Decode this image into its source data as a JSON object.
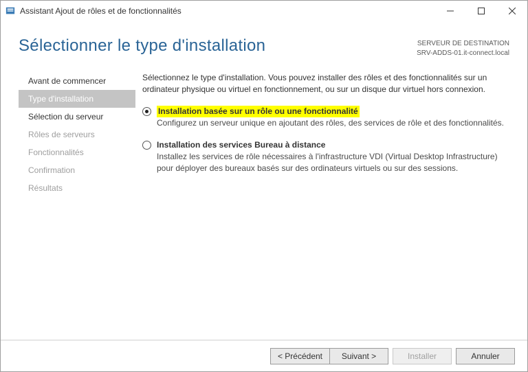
{
  "window": {
    "title": "Assistant Ajout de rôles et de fonctionnalités"
  },
  "header": {
    "title": "Sélectionner le type d'installation",
    "destination_label": "SERVEUR DE DESTINATION",
    "destination_value": "SRV-ADDS-01.it-connect.local"
  },
  "sidebar": {
    "items": [
      {
        "label": "Avant de commencer",
        "enabled": true,
        "active": false
      },
      {
        "label": "Type d'installation",
        "enabled": true,
        "active": true
      },
      {
        "label": "Sélection du serveur",
        "enabled": true,
        "active": false
      },
      {
        "label": "Rôles de serveurs",
        "enabled": false,
        "active": false
      },
      {
        "label": "Fonctionnalités",
        "enabled": false,
        "active": false
      },
      {
        "label": "Confirmation",
        "enabled": false,
        "active": false
      },
      {
        "label": "Résultats",
        "enabled": false,
        "active": false
      }
    ]
  },
  "main": {
    "intro": "Sélectionnez le type d'installation. Vous pouvez installer des rôles et des fonctionnalités sur un ordinateur physique ou virtuel en fonctionnement, ou sur un disque dur virtuel hors connexion.",
    "options": [
      {
        "title": "Installation basée sur un rôle ou une fonctionnalité",
        "desc": "Configurez un serveur unique en ajoutant des rôles, des services de rôle et des fonctionnalités.",
        "selected": true,
        "highlighted": true
      },
      {
        "title": "Installation des services Bureau à distance",
        "desc": "Installez les services de rôle nécessaires à l'infrastructure VDI (Virtual Desktop Infrastructure) pour déployer des bureaux basés sur des ordinateurs virtuels ou sur des sessions.",
        "selected": false,
        "highlighted": false
      }
    ]
  },
  "footer": {
    "previous": "< Précédent",
    "next": "Suivant >",
    "install": "Installer",
    "cancel": "Annuler"
  }
}
